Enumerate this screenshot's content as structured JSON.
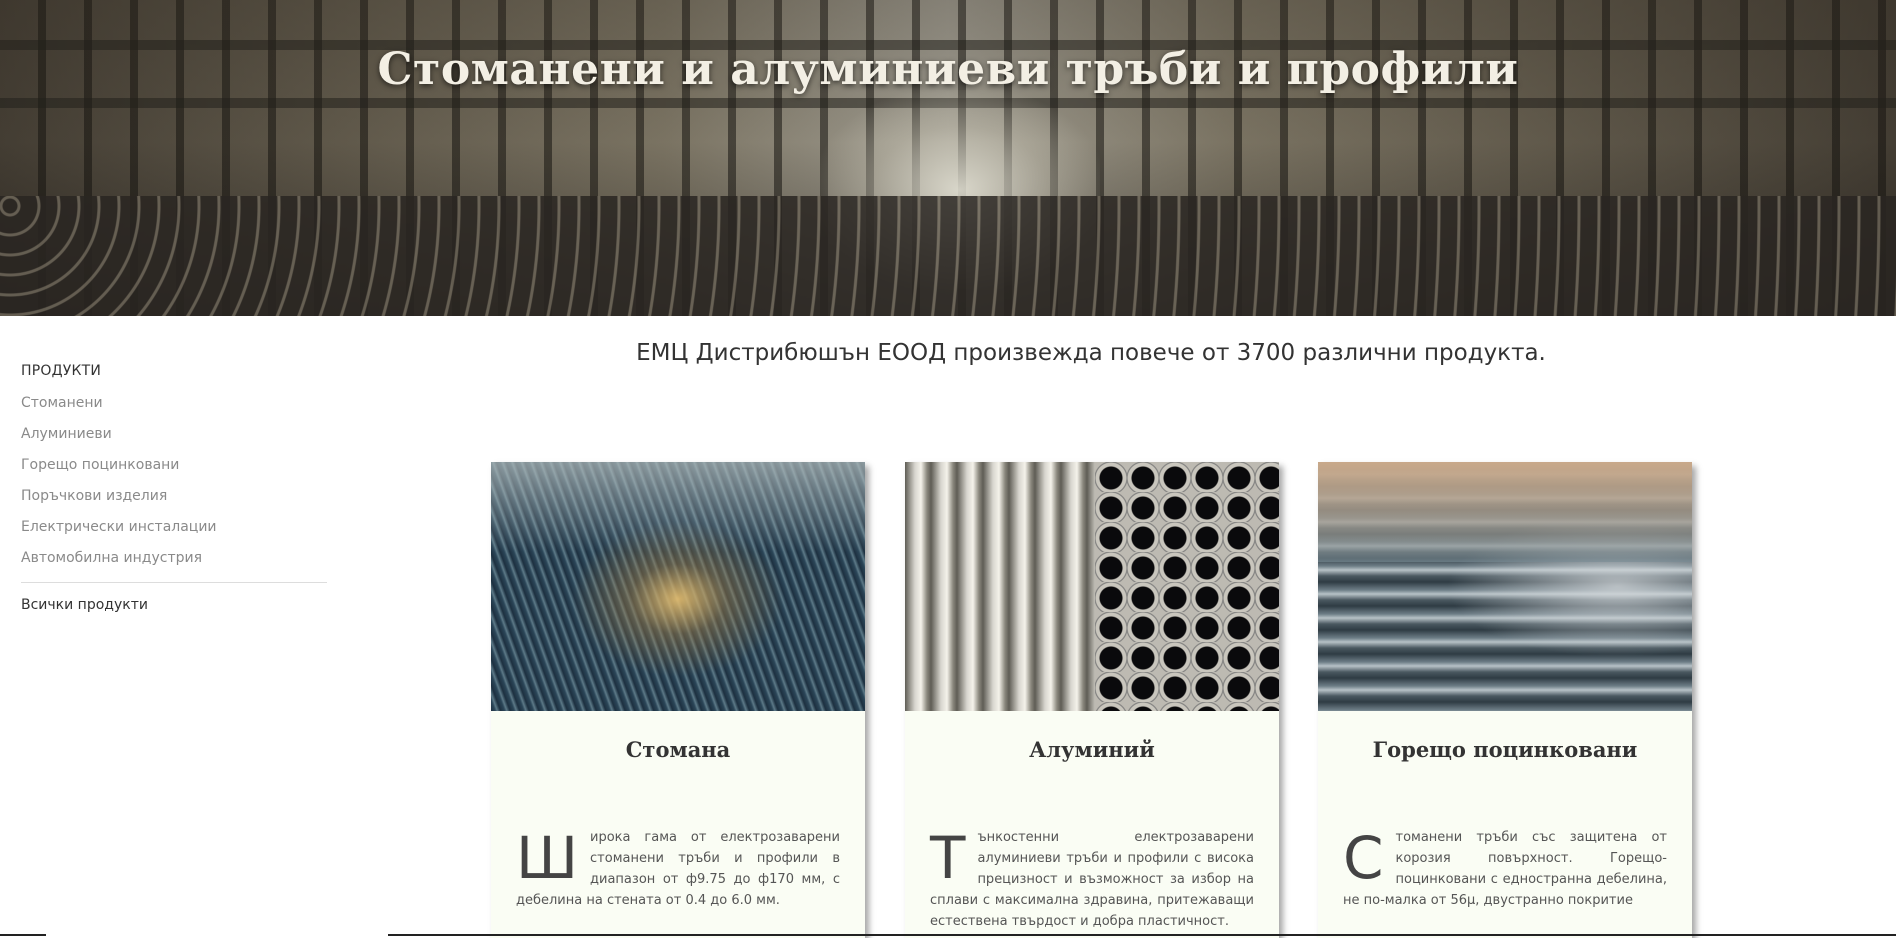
{
  "hero": {
    "title": "Стоманени и алуминиеви тръби и профили"
  },
  "sidebar": {
    "heading": "ПРОДУКТИ",
    "items": [
      {
        "label": "Стоманени"
      },
      {
        "label": "Алуминиеви"
      },
      {
        "label": "Горещо поцинковани"
      },
      {
        "label": "Поръчкови изделия"
      },
      {
        "label": "Електрически инсталации"
      },
      {
        "label": "Автомобилна индустрия"
      }
    ],
    "all_products": "Всички продукти"
  },
  "main": {
    "intro": "ЕМЦ Дистрибюшън ЕООД произвежда повече от 3700 различни продукта.",
    "cards": [
      {
        "title": "Стомана",
        "dropcap": "Ш",
        "text": "ирока гама от електрозаварени стоманени тръби и профили в диапазон от ф9.75 до ф170 мм, с дебелина на стената от 0.4 до 6.0 мм."
      },
      {
        "title": "Алуминий",
        "dropcap": "Т",
        "text": "ънкостенни електрозаварени алуминиеви тръби и профили с висока прецизност и възможност за избор на сплави с максимална здравина, притежаващи естествена твърдост и добра пластичност."
      },
      {
        "title": "Горещо поцинковани",
        "dropcap": "С",
        "text": "томанени тръби със защитена от корозия повърхност. Горещо-поцинковани с едностранна дебелина, не по-малка от 56µ, двустранно покритие"
      }
    ]
  }
}
